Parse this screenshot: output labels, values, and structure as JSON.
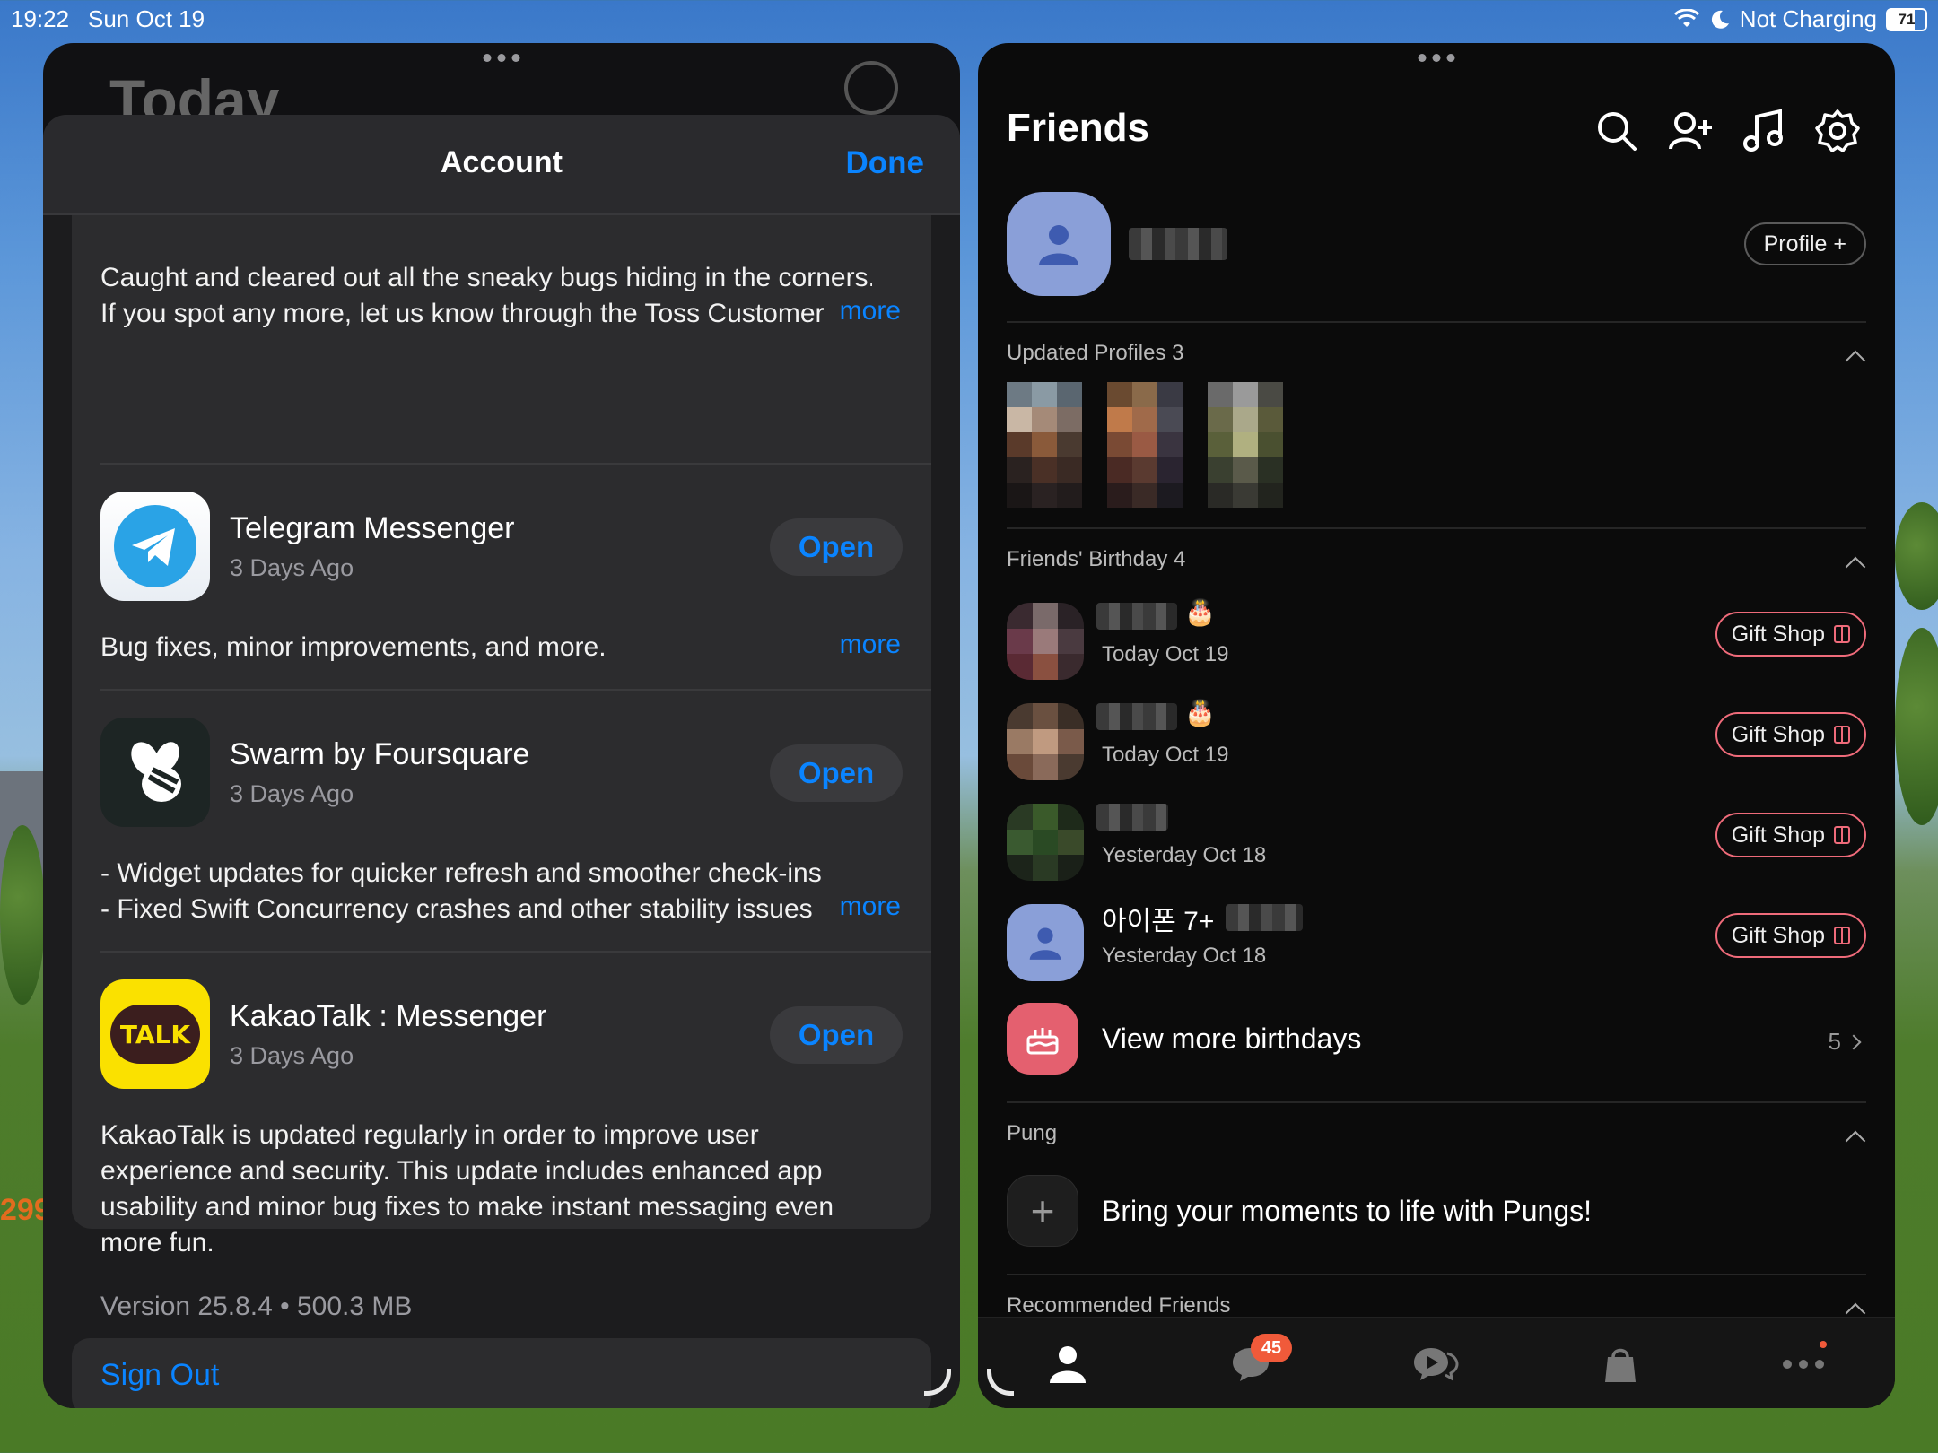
{
  "status_bar": {
    "time": "19:22",
    "date": "Sun Oct 19",
    "charging": "Not Charging",
    "battery": "71"
  },
  "wallpaper": {
    "sign_text": "299"
  },
  "appstore": {
    "background_title": "Today",
    "sheet_title": "Account",
    "done_label": "Done",
    "more_label": "more",
    "top_notes": [
      "Caught and cleared out all the sneaky bugs hiding in the corners.",
      "If you spot any more, let us know through the Toss Customer Center"
    ],
    "apps": [
      {
        "name": "Telegram Messenger",
        "date": "3 Days Ago",
        "button": "Open",
        "notes": [
          "Bug fixes, minor improvements, and more."
        ]
      },
      {
        "name": "Swarm by Foursquare",
        "date": "3 Days Ago",
        "button": "Open",
        "notes": [
          "- Widget updates for quicker refresh and smoother check-ins",
          "- Fixed Swift Concurrency crashes and other stability issues"
        ]
      },
      {
        "name": "KakaoTalk : Messenger",
        "date": "3 Days Ago",
        "button": "Open",
        "icon_text": "TALK",
        "notes": [
          "KakaoTalk is updated regularly in order to improve user",
          "experience and security. This update includes enhanced app",
          "usability and minor bug fixes to make instant messaging even",
          "more fun."
        ],
        "version": "Version 25.8.4 • 500.3 MB"
      }
    ],
    "sign_out_label": "Sign Out"
  },
  "kakaotalk": {
    "title": "Friends",
    "profile_button": "Profile +",
    "sections": {
      "updated_profiles": "Updated Profiles 3",
      "birthdays": "Friends' Birthday 4",
      "pung": "Pung",
      "recommended": "Recommended Friends"
    },
    "birthdays": [
      {
        "name": "",
        "date": "Today Oct 19",
        "cake": true,
        "button": "Gift Shop"
      },
      {
        "name": "",
        "date": "Today Oct 19",
        "cake": true,
        "button": "Gift Shop"
      },
      {
        "name": "",
        "date": "Yesterday Oct 18",
        "cake": false,
        "button": "Gift Shop"
      },
      {
        "name": "아이폰 7+",
        "date": "Yesterday Oct 18",
        "cake": false,
        "button": "Gift Shop"
      }
    ],
    "view_more": {
      "label": "View more birthdays",
      "count": "5"
    },
    "pung_prompt": "Bring your moments to life with Pungs!",
    "tabbar": {
      "chat_badge": "45"
    }
  },
  "colors": {
    "link_blue": "#0a84ff",
    "gift_accent": "#ef6b7a",
    "badge_red": "#f05a3a",
    "avatar_blue": "#8a9fd8"
  }
}
